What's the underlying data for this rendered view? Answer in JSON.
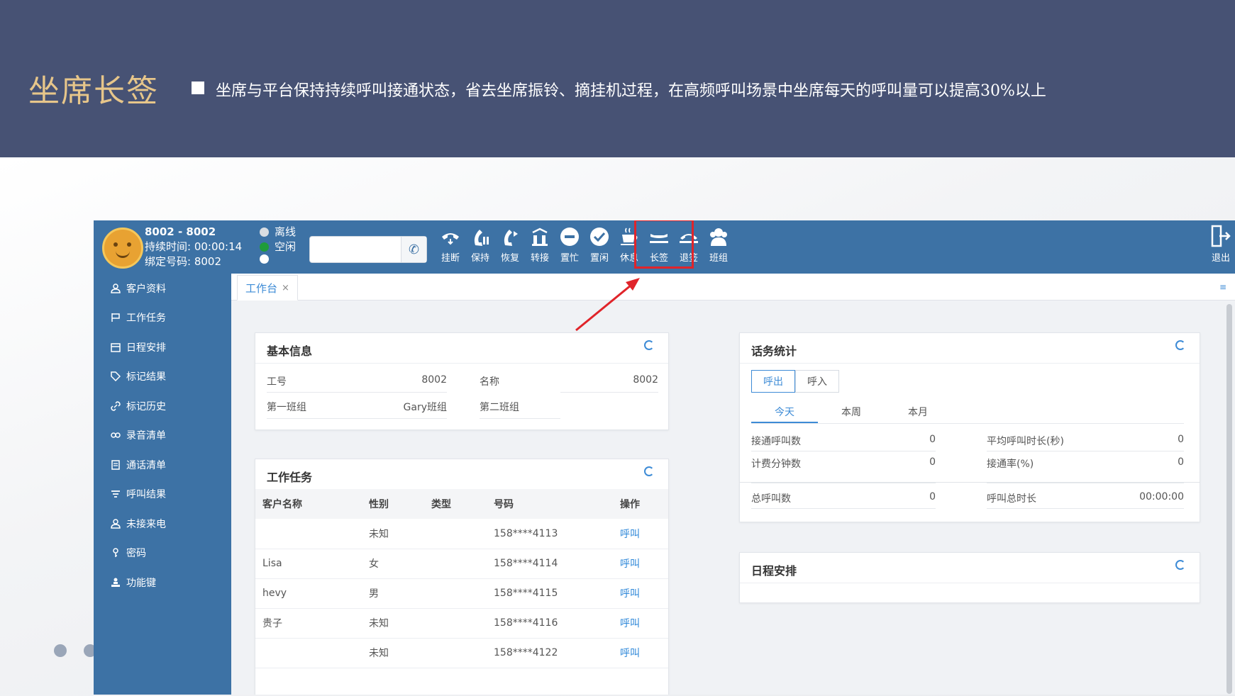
{
  "slide": {
    "title": "坐席长签",
    "description": "坐席与平台保持持续呼叫接通状态，省去坐席振铃、摘挂机过程，在高频呼叫场景中坐席每天的呼叫量可以提高30%以上"
  },
  "agent": {
    "id": "8002 - 8002",
    "duration": "持续时间: 00:00:14",
    "bound_number": "绑定号码: 8002"
  },
  "status": [
    {
      "label": "离线",
      "color": "#d9dde2"
    },
    {
      "label": "空闲",
      "color": "#1f9c3a"
    },
    {
      "label": "",
      "color": "#ffffff"
    }
  ],
  "dial": {
    "placeholder": "",
    "value": ""
  },
  "toolbar": [
    {
      "icon": "hangup-icon",
      "label": "挂断"
    },
    {
      "icon": "hold-icon",
      "label": "保持"
    },
    {
      "icon": "resume-icon",
      "label": "恢复"
    },
    {
      "icon": "transfer-icon",
      "label": "转接"
    },
    {
      "icon": "busy-icon",
      "label": "置忙"
    },
    {
      "icon": "idle-icon",
      "label": "置闲"
    },
    {
      "icon": "rest-icon",
      "label": "休息"
    },
    {
      "icon": "long-sign-icon",
      "label": "长签"
    },
    {
      "icon": "cancel-sign-icon",
      "label": "退签"
    },
    {
      "icon": "team-icon",
      "label": "班组"
    }
  ],
  "logout_label": "退出",
  "sidebar": [
    {
      "icon": "user-icon",
      "label": "客户资料"
    },
    {
      "icon": "flag-icon",
      "label": "工作任务"
    },
    {
      "icon": "calendar-icon",
      "label": "日程安排"
    },
    {
      "icon": "tag-icon",
      "label": "标记结果"
    },
    {
      "icon": "link-icon",
      "label": "标记历史"
    },
    {
      "icon": "recording-icon",
      "label": "录音清单"
    },
    {
      "icon": "list-icon",
      "label": "通话清单"
    },
    {
      "icon": "filter-icon",
      "label": "呼叫结果"
    },
    {
      "icon": "user-icon",
      "label": "未接来电"
    },
    {
      "icon": "key-icon",
      "label": "密码"
    },
    {
      "icon": "function-icon",
      "label": "功能键"
    }
  ],
  "tab": {
    "label": "工作台",
    "close": "×"
  },
  "basic_info": {
    "title": "基本信息",
    "fields": [
      {
        "key": "工号",
        "value": "8002"
      },
      {
        "key": "名称",
        "value": "8002"
      },
      {
        "key": "第一班组",
        "value": "Gary班组"
      },
      {
        "key": "第二班组",
        "value": ""
      }
    ]
  },
  "tasks": {
    "title": "工作任务",
    "columns": [
      "客户名称",
      "性别",
      "类型",
      "号码",
      "操作"
    ],
    "rows": [
      {
        "name": "",
        "gender": "未知",
        "type": "",
        "phone": "158****4113",
        "action": "呼叫"
      },
      {
        "name": "Lisa",
        "gender": "女",
        "type": "",
        "phone": "158****4114",
        "action": "呼叫"
      },
      {
        "name": "hevy",
        "gender": "男",
        "type": "",
        "phone": "158****4115",
        "action": "呼叫"
      },
      {
        "name": "贵子",
        "gender": "未知",
        "type": "",
        "phone": "158****4116",
        "action": "呼叫"
      },
      {
        "name": "",
        "gender": "未知",
        "type": "",
        "phone": "158****4122",
        "action": "呼叫"
      }
    ]
  },
  "stats": {
    "title": "话务统计",
    "direction": [
      "呼出",
      "呼入"
    ],
    "periods": [
      "今天",
      "本周",
      "本月"
    ],
    "items": [
      {
        "key": "接通呼叫数",
        "value": "0"
      },
      {
        "key": "平均呼叫时长(秒)",
        "value": "0"
      },
      {
        "key": "计费分钟数",
        "value": "0"
      },
      {
        "key": "接通率(%)",
        "value": "0"
      },
      {
        "key": "总呼叫数",
        "value": "0"
      },
      {
        "key": "呼叫总时长",
        "value": "00:00:00"
      }
    ]
  },
  "schedule": {
    "title": "日程安排"
  }
}
